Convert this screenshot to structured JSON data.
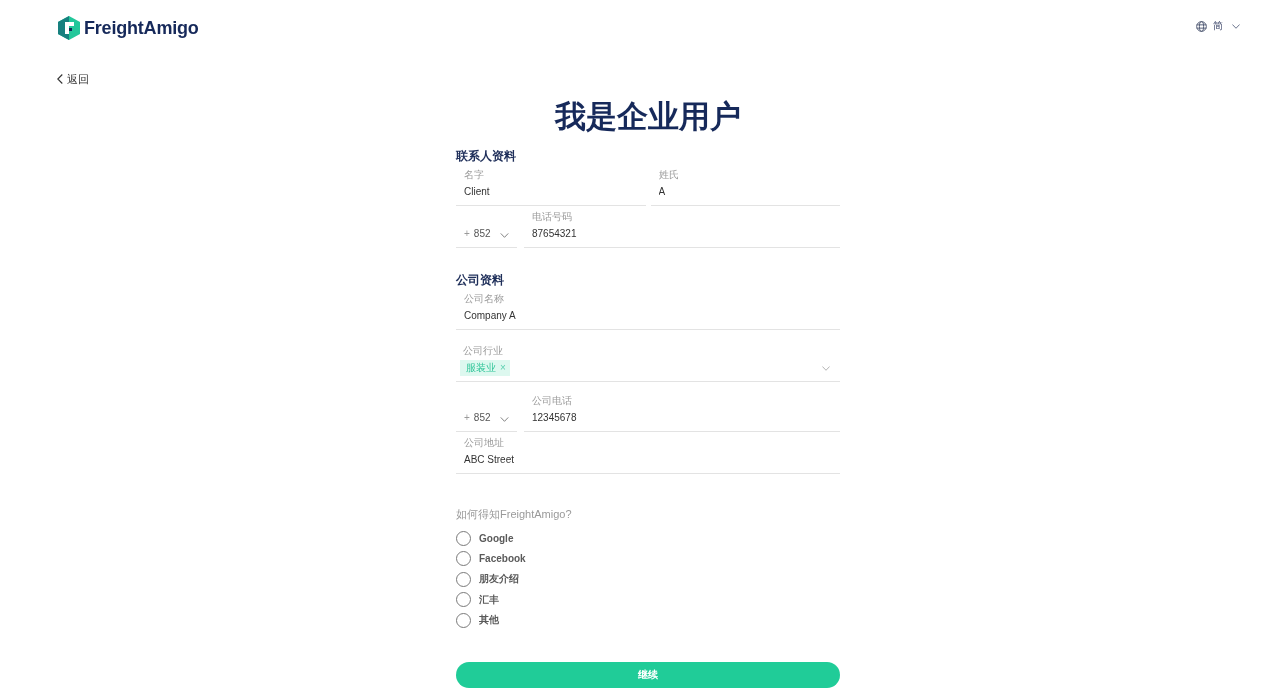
{
  "header": {
    "logo": {
      "text": "FreightAmigo"
    },
    "language": {
      "label": "简"
    }
  },
  "back_link": {
    "label": "返回"
  },
  "title": "我是企业用户",
  "sections": [
    {
      "heading": "联系人资料",
      "rows": [
        [
          {
            "kind": "text",
            "label": "名字",
            "value": "Client"
          },
          {
            "kind": "text",
            "label": "姓氏",
            "value": "A"
          }
        ],
        [
          {
            "kind": "code",
            "prefix": "+",
            "value": "852"
          },
          {
            "kind": "text",
            "label": "电话号码",
            "value": "87654321"
          }
        ]
      ]
    },
    {
      "heading": "公司资料",
      "rows": [
        [
          {
            "kind": "text",
            "label": "公司名称",
            "value": "Company A"
          }
        ],
        [
          {
            "kind": "tags",
            "label": "公司行业",
            "tags": [
              {
                "label": "服装业",
                "remove": "×"
              }
            ]
          }
        ],
        [
          {
            "kind": "code",
            "prefix": "+",
            "value": "852"
          },
          {
            "kind": "text",
            "label": "公司电话",
            "value": "12345678"
          }
        ],
        [
          {
            "kind": "text",
            "label": "公司地址",
            "value": "ABC Street"
          }
        ]
      ]
    }
  ],
  "referral": {
    "question": "如何得知FreightAmigo?",
    "options": [
      {
        "label": "Google",
        "selected": false
      },
      {
        "label": "Facebook",
        "selected": false
      },
      {
        "label": "朋友介绍",
        "selected": false
      },
      {
        "label": "汇丰",
        "selected": false
      },
      {
        "label": "其他",
        "selected": false
      }
    ]
  },
  "submit": {
    "label": "继续"
  }
}
